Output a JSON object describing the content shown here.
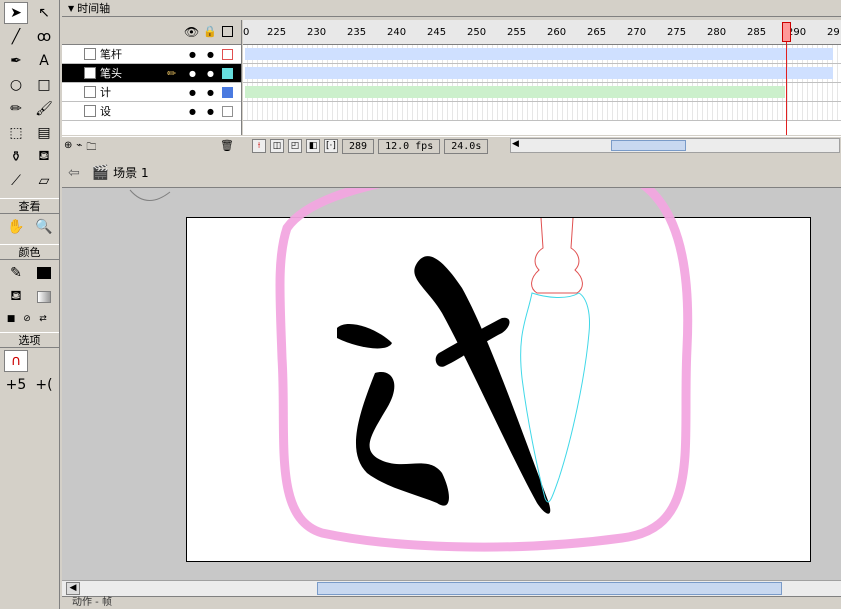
{
  "tools_panel": {
    "view_title": "查看",
    "color_title": "颜色",
    "options_title": "选项"
  },
  "timeline": {
    "title": "时间轴",
    "ruler_ticks": [
      "0",
      "225",
      "230",
      "235",
      "240",
      "245",
      "250",
      "255",
      "260",
      "265",
      "270",
      "275",
      "280",
      "285",
      "290",
      "29"
    ],
    "layers": [
      {
        "name": "笔杆",
        "color": "#e05050",
        "selected": false
      },
      {
        "name": "笔头",
        "color": "#66dddd",
        "selected": true
      },
      {
        "name": "计",
        "color": "#4a7ae0",
        "selected": false
      },
      {
        "name": "设",
        "color": "#c0c0c0",
        "selected": false
      }
    ],
    "current_frame": "289",
    "fps": "12.0 fps",
    "elapsed": "24.0s"
  },
  "scene": {
    "label": "场景 1"
  },
  "bottom_panel": {
    "label": "动作 - 帧"
  },
  "colors": {
    "highlight_circle": "#f2a6e0",
    "brush_outline_handle": "#e05050",
    "brush_outline_tip": "#40d8e8",
    "glyph": "#000000"
  }
}
